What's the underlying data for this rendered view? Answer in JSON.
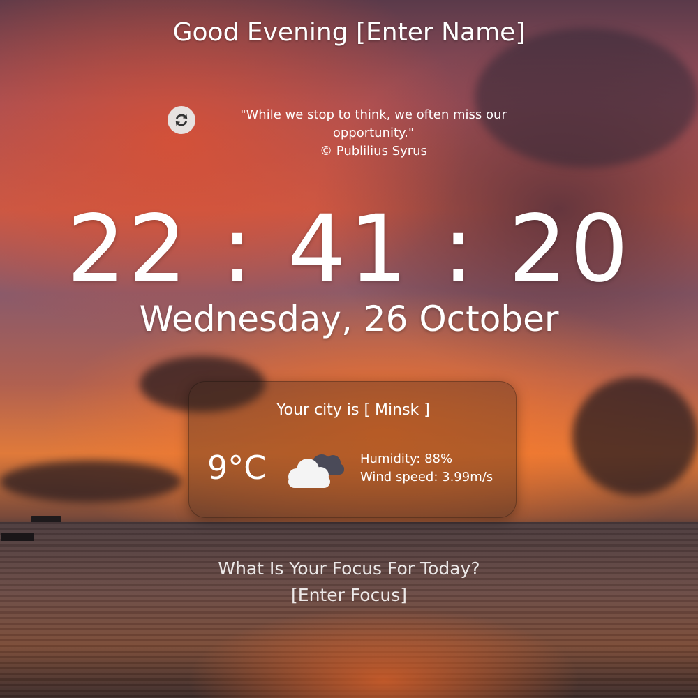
{
  "greeting": "Good Evening [Enter Name]",
  "quote": {
    "text": "\"While we stop to think, we often miss our opportunity.\"",
    "author": "© Publilius Syrus",
    "refresh_icon": "refresh-icon"
  },
  "clock": {
    "time": "22 : 41 : 20"
  },
  "date": "Wednesday, 26 October",
  "weather": {
    "city": "Your city is [ Minsk ]",
    "temperature": "9°C",
    "icon": "cloudy-icon",
    "humidity": "Humidity: 88%",
    "wind": "Wind speed: 3.99m/s"
  },
  "focus": {
    "question": "What Is Your Focus For Today?",
    "placeholder": "[Enter Focus]"
  },
  "colors": {
    "refresh_button_bg": "#e7e2e0",
    "text": "#ffffff"
  }
}
